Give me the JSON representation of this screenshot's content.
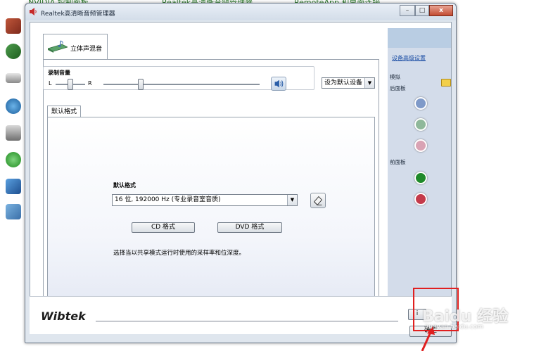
{
  "desktop": {
    "top_items": [
      "NVIDIA 控制面板",
      "Realtek高清晰音频管理器",
      "RemoteApp 和桌面连接"
    ],
    "side_icons": [
      "firewall-icon",
      "backup-icon",
      "keyboard-icon",
      "network-icon",
      "devices-icon",
      "sync-icon",
      "display-icon",
      "computer-icon"
    ]
  },
  "window": {
    "title": "Realtek高清晰音频管理器",
    "buttons": {
      "minimize": "–",
      "maximize": "□",
      "close": "x"
    }
  },
  "tab": {
    "label": "立体声混音"
  },
  "record_volume": {
    "title": "录制音量",
    "left": "L",
    "right": "R",
    "balance_level": 0.5,
    "volume_level": 0.24
  },
  "default_device": {
    "label": "设为默认设备",
    "arrow": "▼"
  },
  "default_format_tab": {
    "label": "默认格式"
  },
  "format": {
    "title": "默认格式",
    "selected": "16 位, 192000 Hz (专业录音室音质)",
    "arrow": "▼",
    "cd_button": "CD 格式",
    "dvd_button": "DVD 格式",
    "description": "选择当以共享模式运行时使用的采样率和位深度。"
  },
  "right_panel": {
    "advanced_link": "设备高级设置",
    "analog_label": "模拟",
    "back_panel_label": "后面板",
    "front_panel_label": "前面板",
    "back_jacks": [
      "#7f9ac9",
      "#8fb89a",
      "#d9a3b4"
    ],
    "front_jacks": [
      "#1f8a2a",
      "#c43a4a"
    ]
  },
  "footer": {
    "brand": "Wibtek",
    "info_button": "i",
    "ok_button": "确定"
  },
  "watermark": {
    "text": "Baidu 经验",
    "sub": "jingyan.baidu.com"
  },
  "colors": {
    "highlight_box": "#e02020",
    "link": "#1d4fa5"
  }
}
